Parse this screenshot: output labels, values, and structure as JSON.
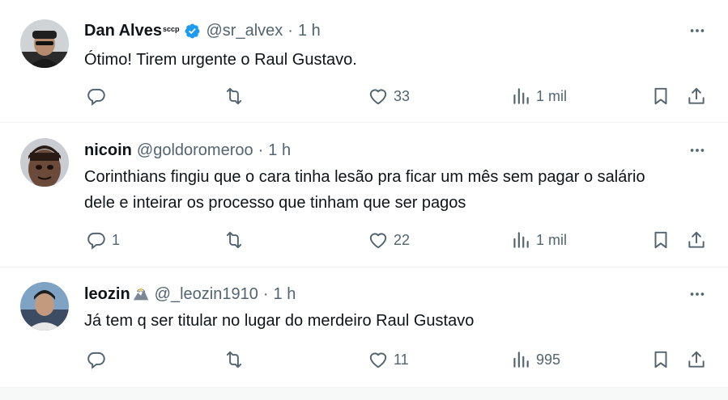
{
  "tweets": [
    {
      "name": "Dan Alves",
      "name_suffix": "sccp",
      "verified": true,
      "handle": "@sr_alvex",
      "separator": "·",
      "time": "1 h",
      "text": "Ótimo! Tirem urgente o Raul Gustavo.",
      "replies": "",
      "retweets": "",
      "likes": "33",
      "views": "1 mil"
    },
    {
      "name": "nicoin",
      "name_suffix": "",
      "verified": false,
      "handle": "@goldoromeroo",
      "separator": "·",
      "time": "1 h",
      "text": "Corinthians fingiu que o cara tinha lesão pra ficar um mês sem pagar o salário dele e inteirar os processo que tinham que ser pagos",
      "replies": "1",
      "retweets": "",
      "likes": "22",
      "views": "1 mil"
    },
    {
      "name": "leozin",
      "name_suffix": "",
      "verified": false,
      "handle": "@_leozin1910",
      "separator": "·",
      "time": "1 h",
      "text": "Já tem q ser titular no lugar do merdeiro Raul Gustavo",
      "replies": "",
      "retweets": "",
      "likes": "11",
      "views": "995"
    }
  ],
  "icons": {
    "verified": "verified-badge-icon",
    "more": "more-dots-icon",
    "reply": "reply-bubble-icon",
    "retweet": "retweet-icon",
    "like": "heart-icon",
    "views": "views-bar-chart-icon",
    "bookmark": "bookmark-icon",
    "share": "share-icon",
    "emoji": "eagle-emoji-icon"
  },
  "colors": {
    "text_primary": "#0f1419",
    "text_secondary": "#536471",
    "verified_blue": "#1d9bf0",
    "divider": "#eff3f4"
  }
}
